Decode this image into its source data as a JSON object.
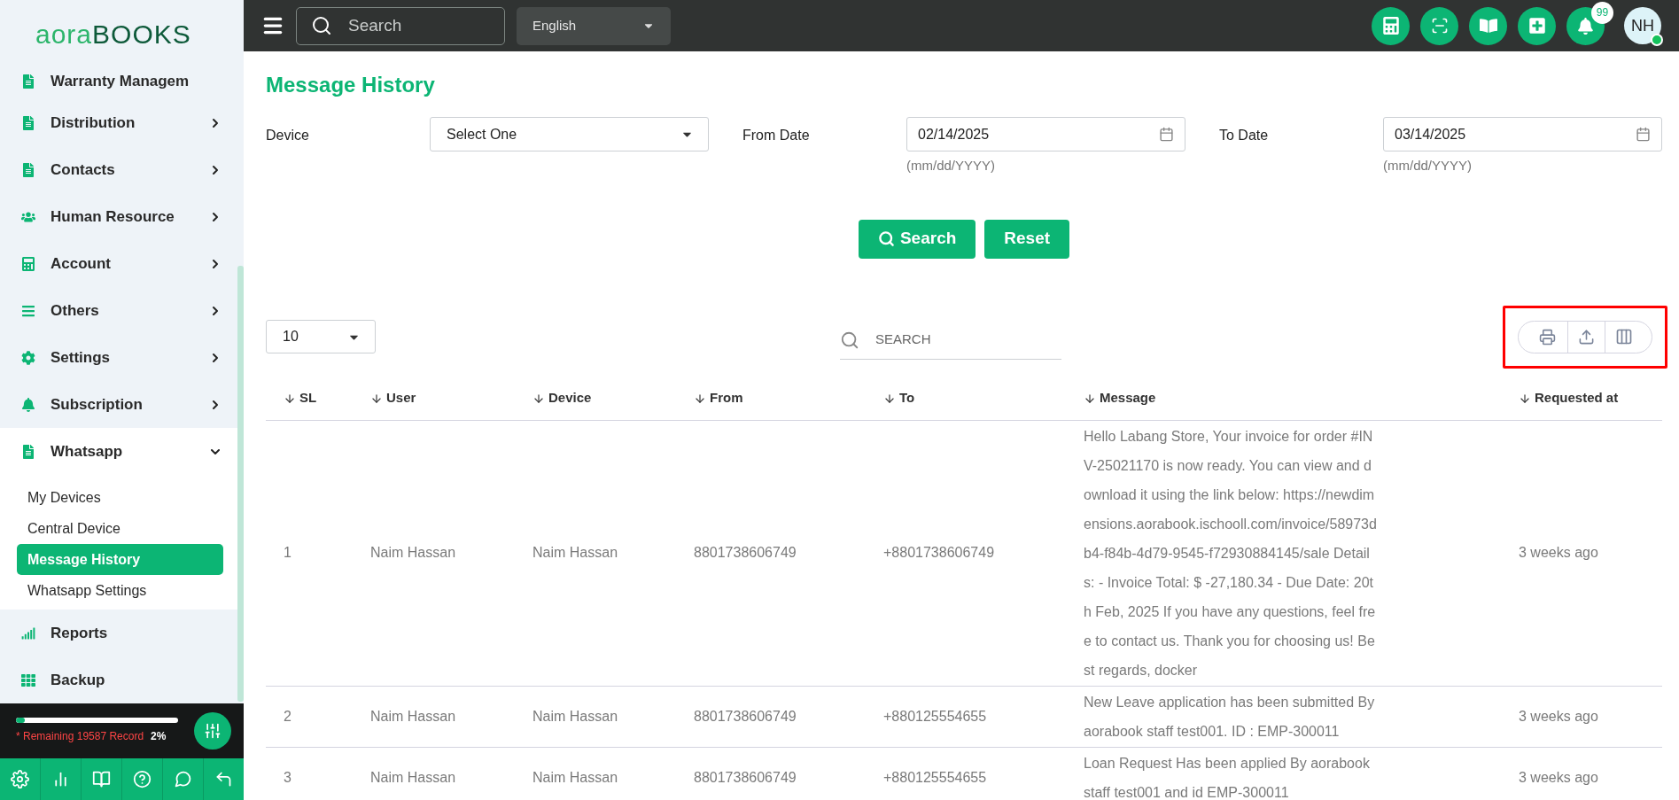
{
  "brand": {
    "logo_left": "aora",
    "logo_right": "BOOKS"
  },
  "header": {
    "search_placeholder": "Search",
    "language": "English",
    "notifications_count": "99",
    "avatar_initials": "NH",
    "online": true
  },
  "sidebar": {
    "items": [
      {
        "label": "Warranty Managem",
        "kind": "document",
        "has_submenu": false,
        "expanded": false
      },
      {
        "label": "Distribution",
        "kind": "document",
        "has_submenu": true,
        "expanded": false
      },
      {
        "label": "Contacts",
        "kind": "document",
        "has_submenu": true,
        "expanded": false
      },
      {
        "label": "Human Resource",
        "kind": "people",
        "has_submenu": true,
        "expanded": false
      },
      {
        "label": "Account",
        "kind": "calculator",
        "has_submenu": true,
        "expanded": false
      },
      {
        "label": "Others",
        "kind": "list",
        "has_submenu": true,
        "expanded": false
      },
      {
        "label": "Settings",
        "kind": "gear",
        "has_submenu": true,
        "expanded": false
      },
      {
        "label": "Subscription",
        "kind": "bell",
        "has_submenu": true,
        "expanded": false
      },
      {
        "label": "Whatsapp",
        "kind": "document",
        "has_submenu": true,
        "expanded": true,
        "children": [
          {
            "label": "My Devices",
            "selected": false
          },
          {
            "label": "Central Device",
            "selected": false
          },
          {
            "label": "Message History",
            "selected": true
          },
          {
            "label": "Whatsapp Settings",
            "selected": false
          }
        ]
      },
      {
        "label": "Reports",
        "kind": "signal",
        "has_submenu": false,
        "expanded": false
      },
      {
        "label": "Backup",
        "kind": "grid",
        "has_submenu": false,
        "expanded": false
      }
    ]
  },
  "usage": {
    "level": 0.02,
    "text": "* Remaining 19587 Record",
    "percent": "2%"
  },
  "page": {
    "title": "Message History",
    "filters": [
      {
        "label": "Device",
        "kind": "select",
        "value": "Select One"
      },
      {
        "label": "From Date",
        "kind": "date",
        "value": "02/14/2025",
        "hint": "(mm/dd/YYYY)"
      },
      {
        "label": "To Date",
        "kind": "date",
        "value": "03/14/2025",
        "hint": "(mm/dd/YYYY)"
      }
    ],
    "buttons": [
      {
        "label": "Search",
        "kind": "search"
      },
      {
        "label": "Reset",
        "kind": "plain"
      }
    ],
    "page_size": "10",
    "table_search_placeholder": "SEARCH",
    "export_tools": {
      "highlighted": true
    },
    "table": {
      "columns": [
        "SL",
        "User",
        "Device",
        "From",
        "To",
        "Message",
        "Requested at"
      ],
      "rows": [
        {
          "sl": "1",
          "user": "Naim Hassan",
          "device": "Naim Hassan",
          "from": "8801738606749",
          "to": "+8801738606749",
          "message": "Hello Labang Store, Your invoice for order #INV-25021170 is now ready. You can view and download it using the link below: https://newdimensions.aorabook.ischooll.com/invoice/58973db4-f84b-4d79-9545-f72930884145/sale Details: - Invoice Total: $ -27,180.34 - Due Date: 20th Feb, 2025 If you have any questions, feel free to contact us. Thank you for choosing us! Best regards, docker",
          "requested_at": "3 weeks ago"
        },
        {
          "sl": "2",
          "user": "Naim Hassan",
          "device": "Naim Hassan",
          "from": "8801738606749",
          "to": "+880125554655",
          "message": "New Leave application has been submitted By aorabook staff test001. ID : EMP-300011",
          "requested_at": "3 weeks ago"
        },
        {
          "sl": "3",
          "user": "Naim Hassan",
          "device": "Naim Hassan",
          "from": "8801738606749",
          "to": "+880125554655",
          "message": "Loan Request Has been applied By aorabook staff test001 and id EMP-300011",
          "requested_at": "3 weeks ago"
        }
      ]
    }
  }
}
